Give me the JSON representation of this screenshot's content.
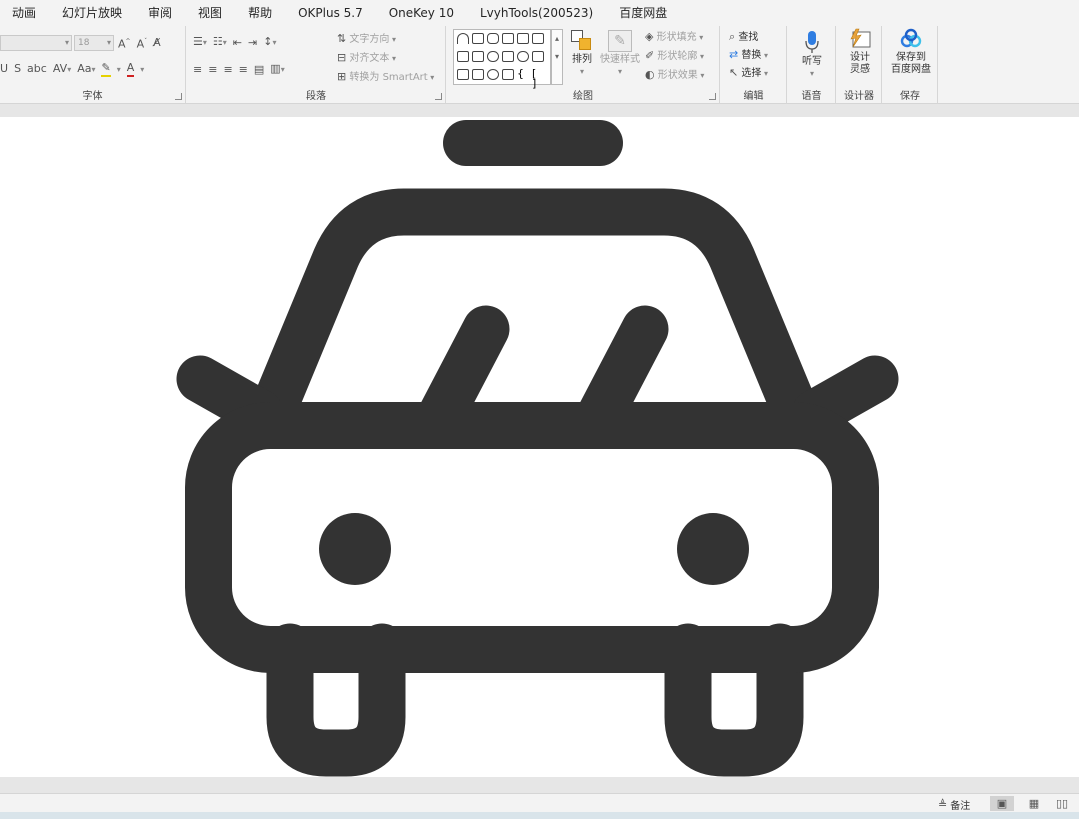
{
  "tabs": [
    "动画",
    "幻灯片放映",
    "审阅",
    "视图",
    "帮助",
    "OKPlus 5.7",
    "OneKey 10",
    "LvyhTools(200523)",
    "百度网盘"
  ],
  "ribbon": {
    "font_group": {
      "label": "字体",
      "font_size_value": "18"
    },
    "paragraph_group": {
      "label": "段落",
      "text_direction": "文字方向",
      "align_text": "对齐文本",
      "convert_smartart": "转换为 SmartArt"
    },
    "drawing_group": {
      "label": "绘图",
      "arrange": "排列",
      "quick_styles": "快速样式",
      "shape_fill": "形状填充",
      "shape_outline": "形状轮廓",
      "shape_effects": "形状效果"
    },
    "editing_group": {
      "label": "编辑",
      "find": "查找",
      "replace": "替换",
      "select": "选择"
    },
    "voice_group": {
      "label": "语音",
      "dictate": "听写"
    },
    "designer_group": {
      "label": "设计器",
      "design_ideas_line1": "设计",
      "design_ideas_line2": "灵感"
    },
    "save_group": {
      "label": "保存",
      "save_to_line1": "保存到",
      "save_to_line2": "百度网盘"
    }
  },
  "slide": {
    "icon_name": "taxi-icon",
    "icon_color": "#333333",
    "background": "#ffffff"
  },
  "status": {
    "notes_label": "备注"
  },
  "colors": {
    "ribbon_bg": "#f3f3f3",
    "workspace_bg": "#e6e6e6",
    "baidu_blue": "#2f7de1",
    "designer_orange": "#e8a33d"
  }
}
